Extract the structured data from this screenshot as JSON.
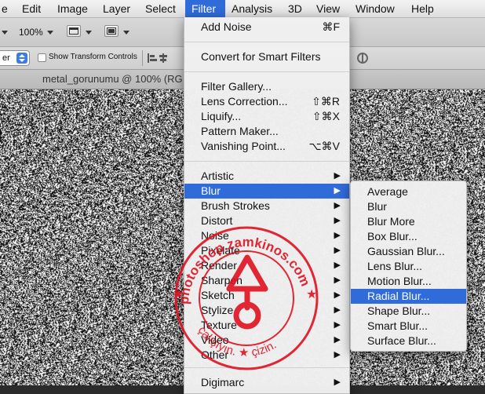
{
  "menubar": {
    "items": [
      "e",
      "Edit",
      "Image",
      "Layer",
      "Select",
      "Filter",
      "Analysis",
      "3D",
      "View",
      "Window",
      "Help"
    ],
    "active": "Filter"
  },
  "options": {
    "zoom": "100%",
    "mode_value": "er",
    "show_transform_label": "Show Transform Controls"
  },
  "document": {
    "tab_title": "metal_gorunumu @ 100% (RG"
  },
  "filter_menu": {
    "add_noise": {
      "label": "Add Noise",
      "shortcut": "⌘F"
    },
    "convert_smart": "Convert for Smart Filters",
    "filter_gallery": "Filter Gallery...",
    "lens_correction": {
      "label": "Lens Correction...",
      "shortcut": "⇧⌘R"
    },
    "liquify": {
      "label": "Liquify...",
      "shortcut": "⇧⌘X"
    },
    "pattern_maker": "Pattern Maker...",
    "vanishing_point": {
      "label": "Vanishing Point...",
      "shortcut": "⌥⌘V"
    },
    "submenus": [
      "Artistic",
      "Blur",
      "Brush Strokes",
      "Distort",
      "Noise",
      "Pixelate",
      "Render",
      "Sharpen",
      "Sketch",
      "Stylize",
      "Texture",
      "Video",
      "Other"
    ],
    "highlighted": "Blur",
    "digimarc": "Digimarc"
  },
  "blur_menu": {
    "items": [
      "Average",
      "Blur",
      "Blur More",
      "Box Blur...",
      "Gaussian Blur...",
      "Lens Blur...",
      "Motion Blur...",
      "Radial Blur...",
      "Shape Blur...",
      "Smart Blur...",
      "Surface Blur..."
    ],
    "highlighted": "Radial Blur..."
  },
  "watermark": {
    "text_top": "photoshop.zamkinos.com",
    "text_bottom": "çalışıyın. ★ çizin.",
    "color": "#e0101e"
  },
  "colors": {
    "highlight": "#2f6bd9",
    "menu_bg": "#f0f0f0"
  }
}
